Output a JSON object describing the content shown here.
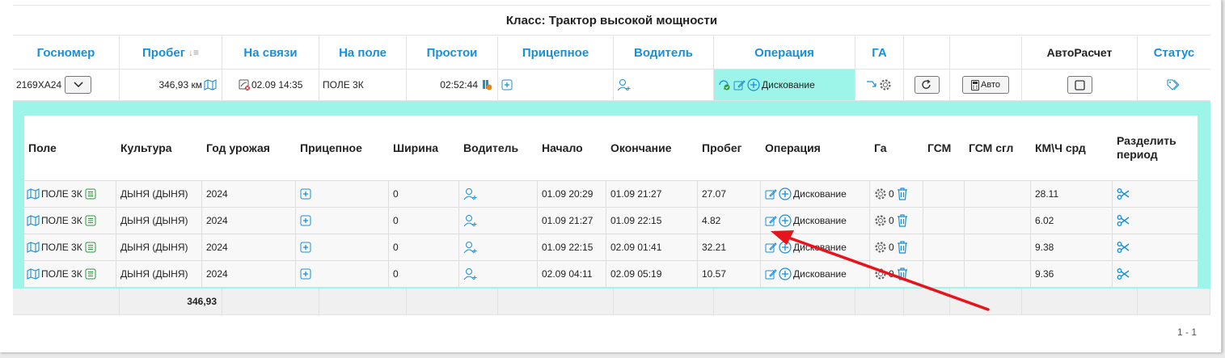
{
  "class_title": "Класс: Трактор высокой мощности",
  "header": {
    "gosnomer": "Госномер",
    "probeg": "Пробег",
    "na_svyazi": "На связи",
    "na_pole": "На поле",
    "prostoi": "Простои",
    "pritsepnoe": "Прицепное",
    "voditel": "Водитель",
    "operatsiya": "Операция",
    "ga": "ГА",
    "autoraschet": "АвтоРасчет",
    "status": "Статус"
  },
  "vehicle": {
    "gosnomer": "2169ХА24",
    "probeg": "346,93 км",
    "na_svyazi": "02.09 14:35",
    "na_pole": "ПОЛЕ 3К",
    "prostoi": "02:52:44",
    "operatsiya": "Дискование",
    "auto_label": "Авто"
  },
  "sub_header": {
    "pole": "Поле",
    "kultura": "Культура",
    "god": "Год урожая",
    "pritsepnoe": "Прицепное",
    "shirina": "Ширина",
    "voditel": "Водитель",
    "nachalo": "Начало",
    "okonchanie": "Окончание",
    "probeg": "Пробег",
    "operatsiya": "Операция",
    "ga": "Га",
    "gsm": "ГСМ",
    "gsm_sgl": "ГСМ сгл",
    "kmch": "КМ\\Ч срд",
    "razdelit": "Разделить период"
  },
  "rows": [
    {
      "pole": "ПОЛЕ 3К",
      "kultura": "ДЫНЯ (ДЫНЯ)",
      "god": "2024",
      "shirina": "0",
      "nachalo": "01.09 20:29",
      "okonchanie": "01.09 21:27",
      "probeg": "27.07",
      "operatsiya": "Дискование",
      "ga": "0",
      "gsm": "",
      "gsm_sgl": "",
      "kmch": "28.11"
    },
    {
      "pole": "ПОЛЕ 3К",
      "kultura": "ДЫНЯ (ДЫНЯ)",
      "god": "2024",
      "shirina": "0",
      "nachalo": "01.09 21:27",
      "okonchanie": "01.09 22:15",
      "probeg": "4.82",
      "operatsiya": "Дискование",
      "ga": "0",
      "gsm": "",
      "gsm_sgl": "",
      "kmch": "6.02"
    },
    {
      "pole": "ПОЛЕ 3К",
      "kultura": "ДЫНЯ (ДЫНЯ)",
      "god": "2024",
      "shirina": "0",
      "nachalo": "01.09 22:15",
      "okonchanie": "02.09 01:41",
      "probeg": "32.21",
      "operatsiya": "Дискование",
      "ga": "0",
      "gsm": "",
      "gsm_sgl": "",
      "kmch": "9.38"
    },
    {
      "pole": "ПОЛЕ 3К",
      "kultura": "ДЫНЯ (ДЫНЯ)",
      "god": "2024",
      "shirina": "0",
      "nachalo": "02.09 04:11",
      "okonchanie": "02.09 05:19",
      "probeg": "10.57",
      "operatsiya": "Дискование",
      "ga": "0",
      "gsm": "",
      "gsm_sgl": "",
      "kmch": "9.36"
    }
  ],
  "footer_total": "346,93",
  "pager": "1 - 1",
  "colors": {
    "accent": "#1a8fd6",
    "teal": "#9df4e8",
    "arrow": "#e8141c",
    "highlight": "#9df4e8"
  }
}
